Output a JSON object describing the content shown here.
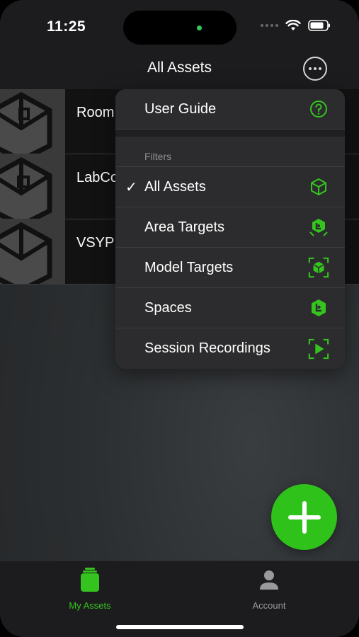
{
  "status": {
    "time": "11:25"
  },
  "nav": {
    "title": "All Assets"
  },
  "assets": [
    {
      "name": "Room"
    },
    {
      "name": "LabCo"
    },
    {
      "name": "VSYP"
    }
  ],
  "menu": {
    "user_guide": "User Guide",
    "filters_header": "Filters",
    "items": [
      {
        "label": "All Assets",
        "checked": true,
        "icon": "cube-icon"
      },
      {
        "label": "Area Targets",
        "checked": false,
        "icon": "area-target-icon"
      },
      {
        "label": "Model Targets",
        "checked": false,
        "icon": "model-target-icon"
      },
      {
        "label": "Spaces",
        "checked": false,
        "icon": "spaces-icon"
      },
      {
        "label": "Session Recordings",
        "checked": false,
        "icon": "session-recording-icon"
      }
    ],
    "check_mark": "✓"
  },
  "tabbar": {
    "assets_label": "My Assets",
    "account_label": "Account"
  },
  "colors": {
    "accent": "#2fc21a",
    "menu_bg": "#2c2c2e",
    "bar_bg": "#1c1c1e"
  }
}
